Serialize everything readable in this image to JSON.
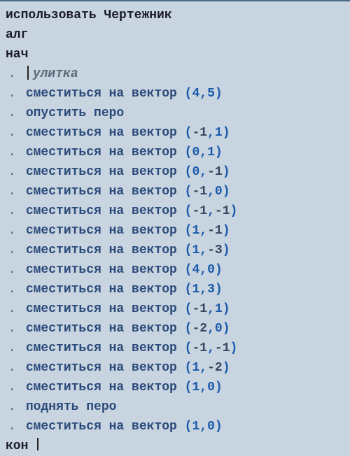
{
  "header": {
    "use": "использовать",
    "executor": "Чертежник",
    "alg": "алг",
    "begin": "нач",
    "end": "кон"
  },
  "comment_name": "улитка",
  "cmds": {
    "move": "сместиться на вектор",
    "pen_down": "опустить перо",
    "pen_up": "поднять перо"
  },
  "lines": [
    {
      "type": "move",
      "x": "4",
      "y": "5"
    },
    {
      "type": "pen_down"
    },
    {
      "type": "move",
      "x": "-1",
      "y": "1"
    },
    {
      "type": "move",
      "x": "0",
      "y": "1"
    },
    {
      "type": "move",
      "x": "0",
      "y": "-1"
    },
    {
      "type": "move",
      "x": "-1",
      "y": "0"
    },
    {
      "type": "move",
      "x": "-1",
      "y": "-1"
    },
    {
      "type": "move",
      "x": "1",
      "y": "-1"
    },
    {
      "type": "move",
      "x": "1",
      "y": "-3"
    },
    {
      "type": "move",
      "x": "4",
      "y": "0"
    },
    {
      "type": "move",
      "x": "1",
      "y": "3"
    },
    {
      "type": "move",
      "x": "-1",
      "y": "1"
    },
    {
      "type": "move",
      "x": "-2",
      "y": "0"
    },
    {
      "type": "move",
      "x": "-1",
      "y": "-1"
    },
    {
      "type": "move",
      "x": "1",
      "y": "-2"
    },
    {
      "type": "move",
      "x": "1",
      "y": "0"
    },
    {
      "type": "pen_up"
    },
    {
      "type": "move",
      "x": "1",
      "y": "0"
    }
  ]
}
